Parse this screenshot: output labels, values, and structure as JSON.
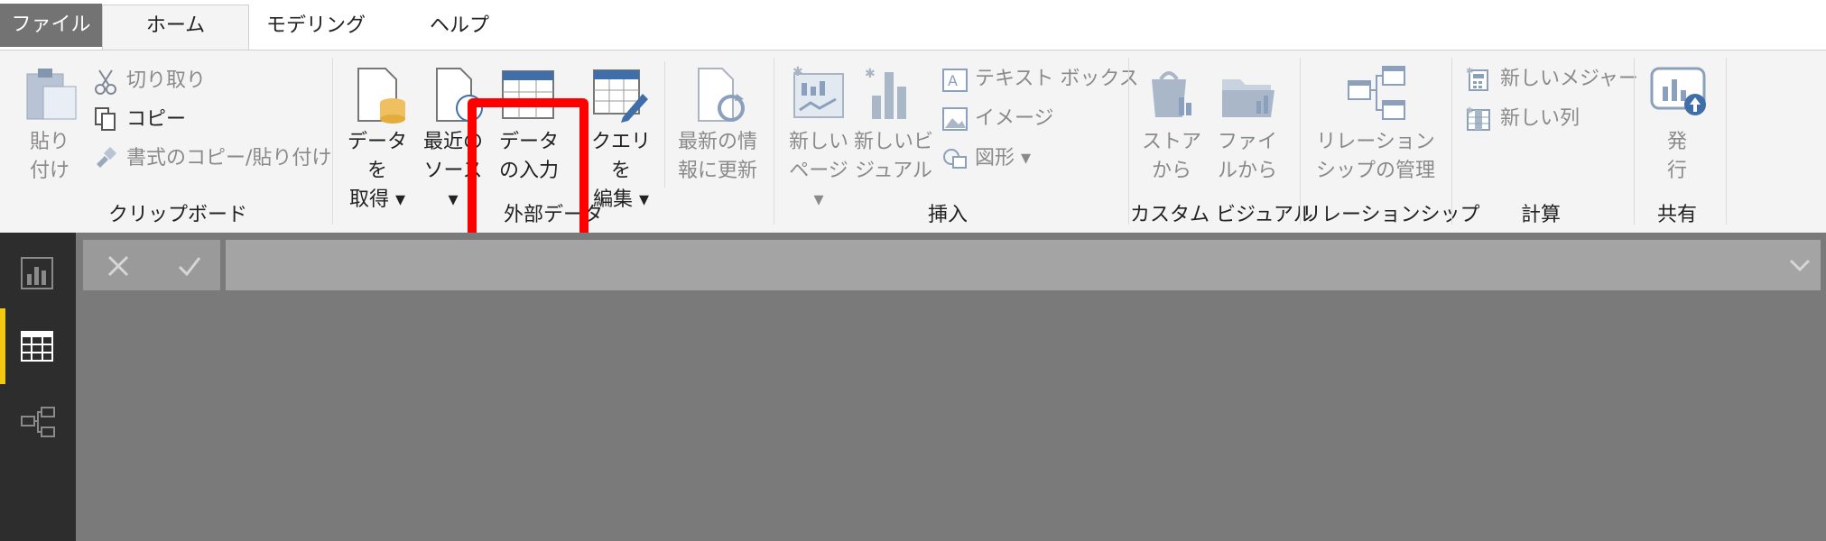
{
  "tabs": {
    "file": "ファイル",
    "home": "ホーム",
    "modeling": "モデリング",
    "help": "ヘルプ"
  },
  "clipboard": {
    "paste_line1": "貼り",
    "paste_line2": "付け",
    "cut": "切り取り",
    "copy": "コピー",
    "format_painter": "書式のコピー/貼り付け",
    "group": "クリップボード"
  },
  "external": {
    "get_data_line1": "データを",
    "get_data_line2": "取得",
    "recent_line1": "最近の",
    "recent_line2": "ソース",
    "enter_data_line1": "データ",
    "enter_data_line2": "の入力",
    "edit_query_line1": "クエリを",
    "edit_query_line2": "編集",
    "refresh_line1": "最新の情",
    "refresh_line2": "報に更新",
    "group": "外部データ"
  },
  "insert": {
    "new_page_line1": "新しい",
    "new_page_line2": "ページ",
    "new_visual_line1": "新しいビ",
    "new_visual_line2": "ジュアル",
    "textbox": "テキスト ボックス",
    "image": "イメージ",
    "shapes": "図形",
    "group": "挿入"
  },
  "custom": {
    "from_store_line1": "ストア",
    "from_store_line2": "から",
    "from_file_line1": "ファイ",
    "from_file_line2": "ルから",
    "group": "カスタム ビジュアル"
  },
  "relationships": {
    "manage_line1": "リレーション",
    "manage_line2": "シップの管理",
    "group": "リレーションシップ"
  },
  "calc": {
    "new_measure": "新しいメジャー",
    "new_column": "新しい列",
    "group": "計算"
  },
  "share": {
    "publish_line1": "発",
    "publish_line2": "行",
    "group": "共有"
  },
  "colors": {
    "highlight": "#ff0000",
    "accent": "#f2c811",
    "icon_blue": "#3f6ea8"
  }
}
